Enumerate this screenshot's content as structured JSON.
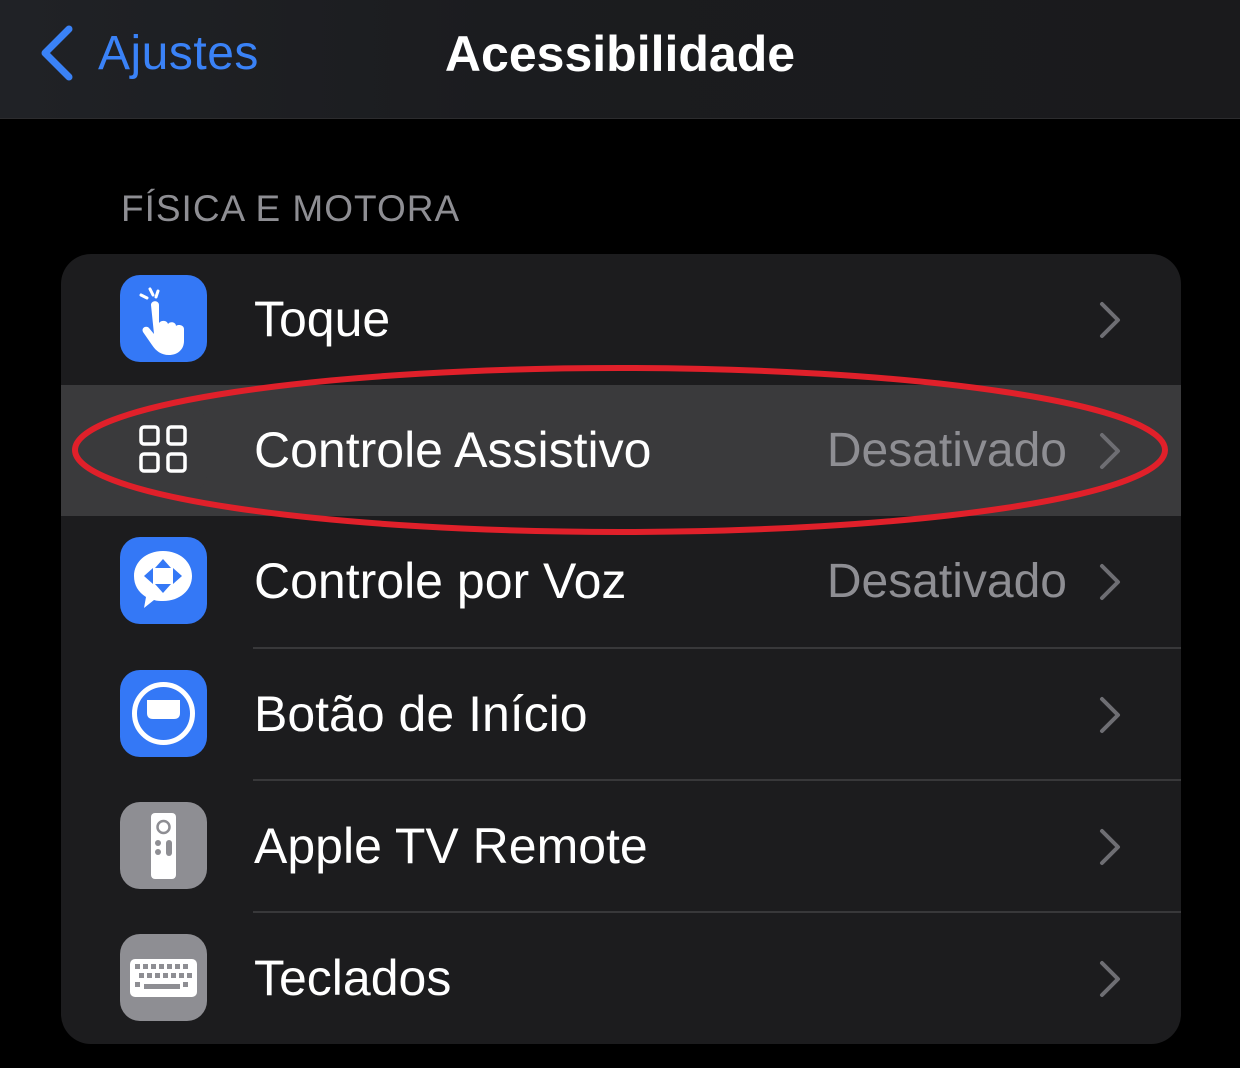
{
  "nav": {
    "back_label": "Ajustes",
    "title": "Acessibilidade"
  },
  "section": {
    "header": "FÍSICA E MOTORA",
    "items": [
      {
        "label": "Toque",
        "value": "",
        "icon": "touch-hand-icon",
        "icon_bg": "#3478f6",
        "highlighted": false
      },
      {
        "label": "Controle Assistivo",
        "value": "Desativado",
        "icon": "switch-control-grid-icon",
        "icon_bg": "#3a3a3c",
        "highlighted": true
      },
      {
        "label": "Controle por Voz",
        "value": "Desativado",
        "icon": "voice-control-icon",
        "icon_bg": "#3478f6",
        "highlighted": false
      },
      {
        "label": "Botão de Início",
        "value": "",
        "icon": "home-button-icon",
        "icon_bg": "#3478f6",
        "highlighted": false
      },
      {
        "label": "Apple TV Remote",
        "value": "",
        "icon": "tv-remote-icon",
        "icon_bg": "#8e8e93",
        "highlighted": false
      },
      {
        "label": "Teclados",
        "value": "",
        "icon": "keyboard-icon",
        "icon_bg": "#8e8e93",
        "highlighted": false
      }
    ]
  },
  "colors": {
    "accent": "#3a82f7",
    "annotation_circle": "#e0202a",
    "secondary_text": "#8e8e93",
    "group_background": "#1c1c1e",
    "highlight_background": "#3a3a3c"
  }
}
